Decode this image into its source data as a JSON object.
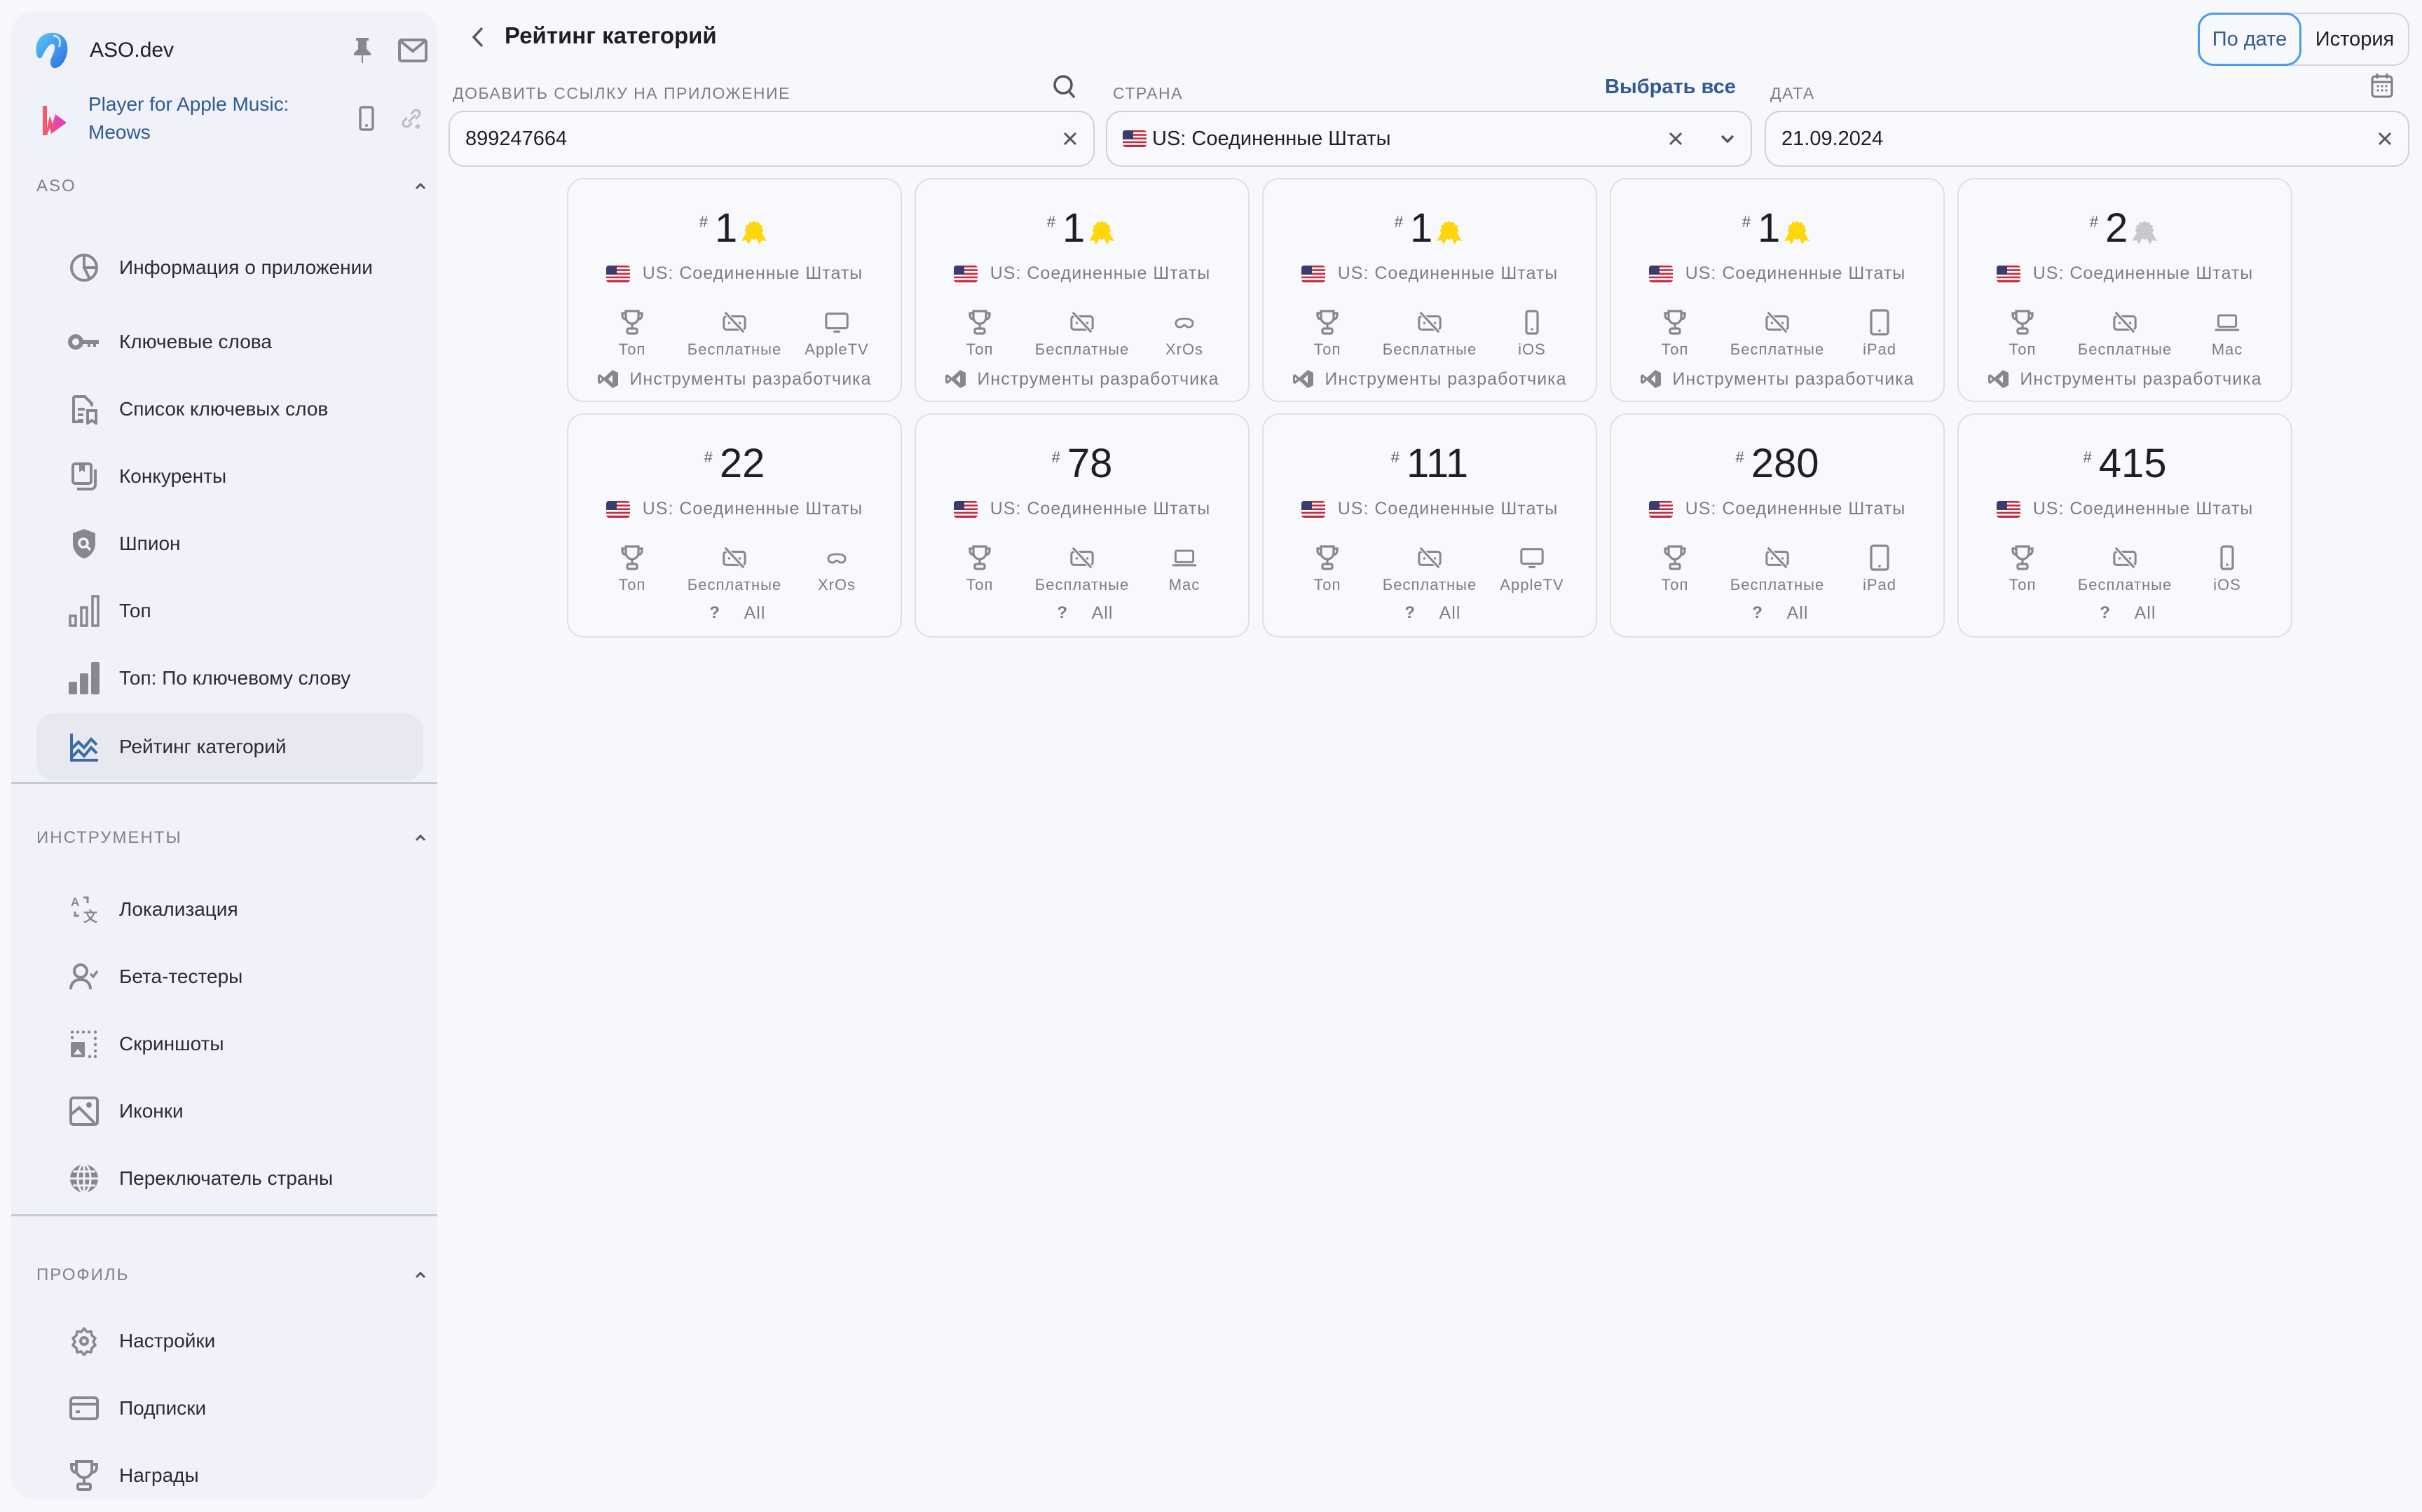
{
  "brand": {
    "name": "ASO.dev"
  },
  "app": {
    "name": "Player for Apple Music: Meows"
  },
  "sidebar": {
    "sections": [
      {
        "title": "ASO",
        "items": [
          {
            "label": "Информация о приложении",
            "icon": "pie-chart-icon"
          },
          {
            "label": "Ключевые слова",
            "icon": "key-icon"
          },
          {
            "label": "Список ключевых слов",
            "icon": "document-list-icon"
          },
          {
            "label": "Конкуренты",
            "icon": "bookmarks-icon"
          },
          {
            "label": "Шпион",
            "icon": "shield-search-icon"
          },
          {
            "label": "Топ",
            "icon": "bar-chart-outline-icon"
          },
          {
            "label": "Топ: По ключевому слову",
            "icon": "bar-chart-icon"
          },
          {
            "label": "Рейтинг категорий",
            "icon": "line-chart-icon",
            "active": true
          }
        ]
      },
      {
        "title": "ИНСТРУМЕНТЫ",
        "items": [
          {
            "label": "Локализация",
            "icon": "translate-icon"
          },
          {
            "label": "Бета-тестеры",
            "icon": "user-check-icon"
          },
          {
            "label": "Скриншоты",
            "icon": "screenshot-icon"
          },
          {
            "label": "Иконки",
            "icon": "image-icon"
          },
          {
            "label": "Переключатель страны",
            "icon": "globe-icon"
          }
        ]
      },
      {
        "title": "ПРОФИЛЬ",
        "items": [
          {
            "label": "Настройки",
            "icon": "gear-icon"
          },
          {
            "label": "Подписки",
            "icon": "credit-card-icon"
          },
          {
            "label": "Награды",
            "icon": "trophy-icon"
          }
        ]
      }
    ]
  },
  "header": {
    "title": "Рейтинг категорий",
    "toggle": {
      "options": [
        "По дате",
        "История"
      ],
      "selected": "По дате"
    }
  },
  "filters": {
    "app_link": {
      "label": "ДОБАВИТЬ ССЫЛКУ НА ПРИЛОЖЕНИЕ",
      "value": "899247664"
    },
    "country": {
      "label": "СТРАНА",
      "select_all": "Выбрать все",
      "value": "US: Соединенные Штаты"
    },
    "date": {
      "label": "ДАТА",
      "value": "21.09.2024"
    }
  },
  "cards": [
    {
      "rank": "1",
      "medal": "gold",
      "country": "US: Соединенные Штаты",
      "chart": "Топ",
      "price": "Бесплатные",
      "platform": "AppleTV",
      "platform_icon": "tv-icon",
      "category": "Инструменты разработчика",
      "category_icon": "dev-tools-icon"
    },
    {
      "rank": "1",
      "medal": "gold",
      "country": "US: Соединенные Штаты",
      "chart": "Топ",
      "price": "Бесплатные",
      "platform": "XrOs",
      "platform_icon": "vision-headset-icon",
      "category": "Инструменты разработчика",
      "category_icon": "dev-tools-icon"
    },
    {
      "rank": "1",
      "medal": "gold",
      "country": "US: Соединенные Штаты",
      "chart": "Топ",
      "price": "Бесплатные",
      "platform": "iOS",
      "platform_icon": "phone-icon",
      "category": "Инструменты разработчика",
      "category_icon": "dev-tools-icon"
    },
    {
      "rank": "1",
      "medal": "gold",
      "country": "US: Соединенные Штаты",
      "chart": "Топ",
      "price": "Бесплатные",
      "platform": "iPad",
      "platform_icon": "tablet-icon",
      "category": "Инструменты разработчика",
      "category_icon": "dev-tools-icon"
    },
    {
      "rank": "2",
      "medal": "silver",
      "country": "US: Соединенные Штаты",
      "chart": "Топ",
      "price": "Бесплатные",
      "platform": "Mac",
      "platform_icon": "laptop-icon",
      "category": "Инструменты разработчика",
      "category_icon": "dev-tools-icon"
    },
    {
      "rank": "22",
      "medal": null,
      "country": "US: Соединенные Штаты",
      "chart": "Топ",
      "price": "Бесплатные",
      "platform": "XrOs",
      "platform_icon": "vision-headset-icon",
      "category": "All",
      "category_icon": "question-icon"
    },
    {
      "rank": "78",
      "medal": null,
      "country": "US: Соединенные Штаты",
      "chart": "Топ",
      "price": "Бесплатные",
      "platform": "Mac",
      "platform_icon": "laptop-icon",
      "category": "All",
      "category_icon": "question-icon"
    },
    {
      "rank": "111",
      "medal": null,
      "country": "US: Соединенные Штаты",
      "chart": "Топ",
      "price": "Бесплатные",
      "platform": "AppleTV",
      "platform_icon": "tv-icon",
      "category": "All",
      "category_icon": "question-icon"
    },
    {
      "rank": "280",
      "medal": null,
      "country": "US: Соединенные Штаты",
      "chart": "Топ",
      "price": "Бесплатные",
      "platform": "iPad",
      "platform_icon": "tablet-icon",
      "category": "All",
      "category_icon": "question-icon"
    },
    {
      "rank": "415",
      "medal": null,
      "country": "US: Соединенные Штаты",
      "chart": "Топ",
      "price": "Бесплатные",
      "platform": "iOS",
      "platform_icon": "phone-icon",
      "category": "All",
      "category_icon": "question-icon"
    }
  ],
  "colors": {
    "accent": "#2f5a93",
    "focus": "#4a9bf0",
    "gold_medal": "#ffd60a",
    "silver_medal": "#c8c9cc"
  }
}
